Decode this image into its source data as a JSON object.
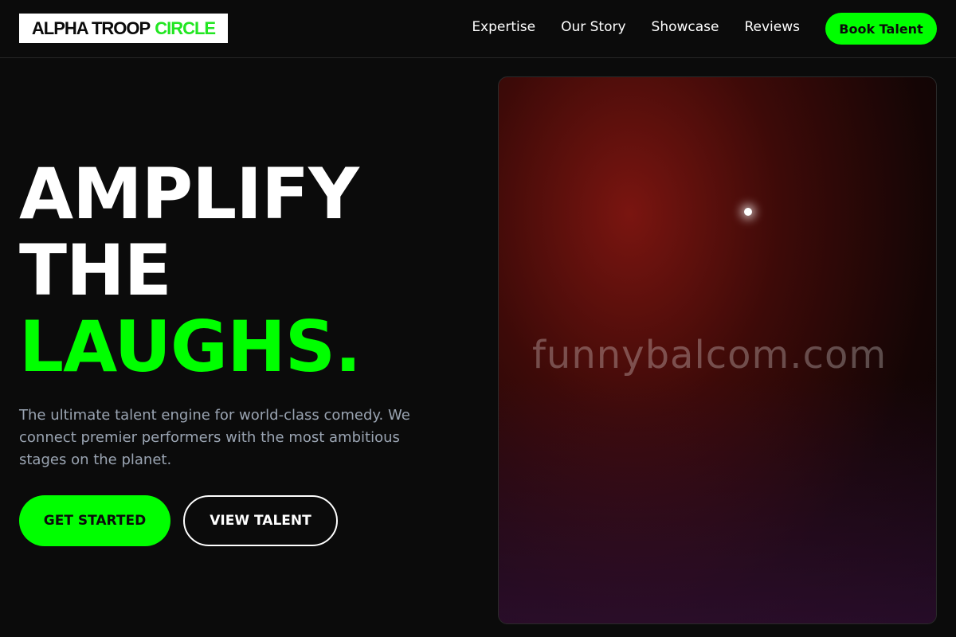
{
  "header": {
    "logo_part1": "ALPHA TROOP",
    "logo_part2": "CIRCLE",
    "nav": [
      "Expertise",
      "Our Story",
      "Showcase",
      "Reviews"
    ],
    "cta_label": "Book Talent"
  },
  "hero": {
    "headline_line1": "AMPLIFY",
    "headline_line2": "THE",
    "headline_line3": "LAUGHS.",
    "subtext": "The ultimate talent engine for world-class comedy. We connect premier performers with the most ambitious stages on the planet.",
    "primary_cta": "GET STARTED",
    "secondary_cta": "VIEW TALENT"
  },
  "image": {
    "watermark": "funnybalcom.com",
    "accent_color": "#00ff00"
  }
}
